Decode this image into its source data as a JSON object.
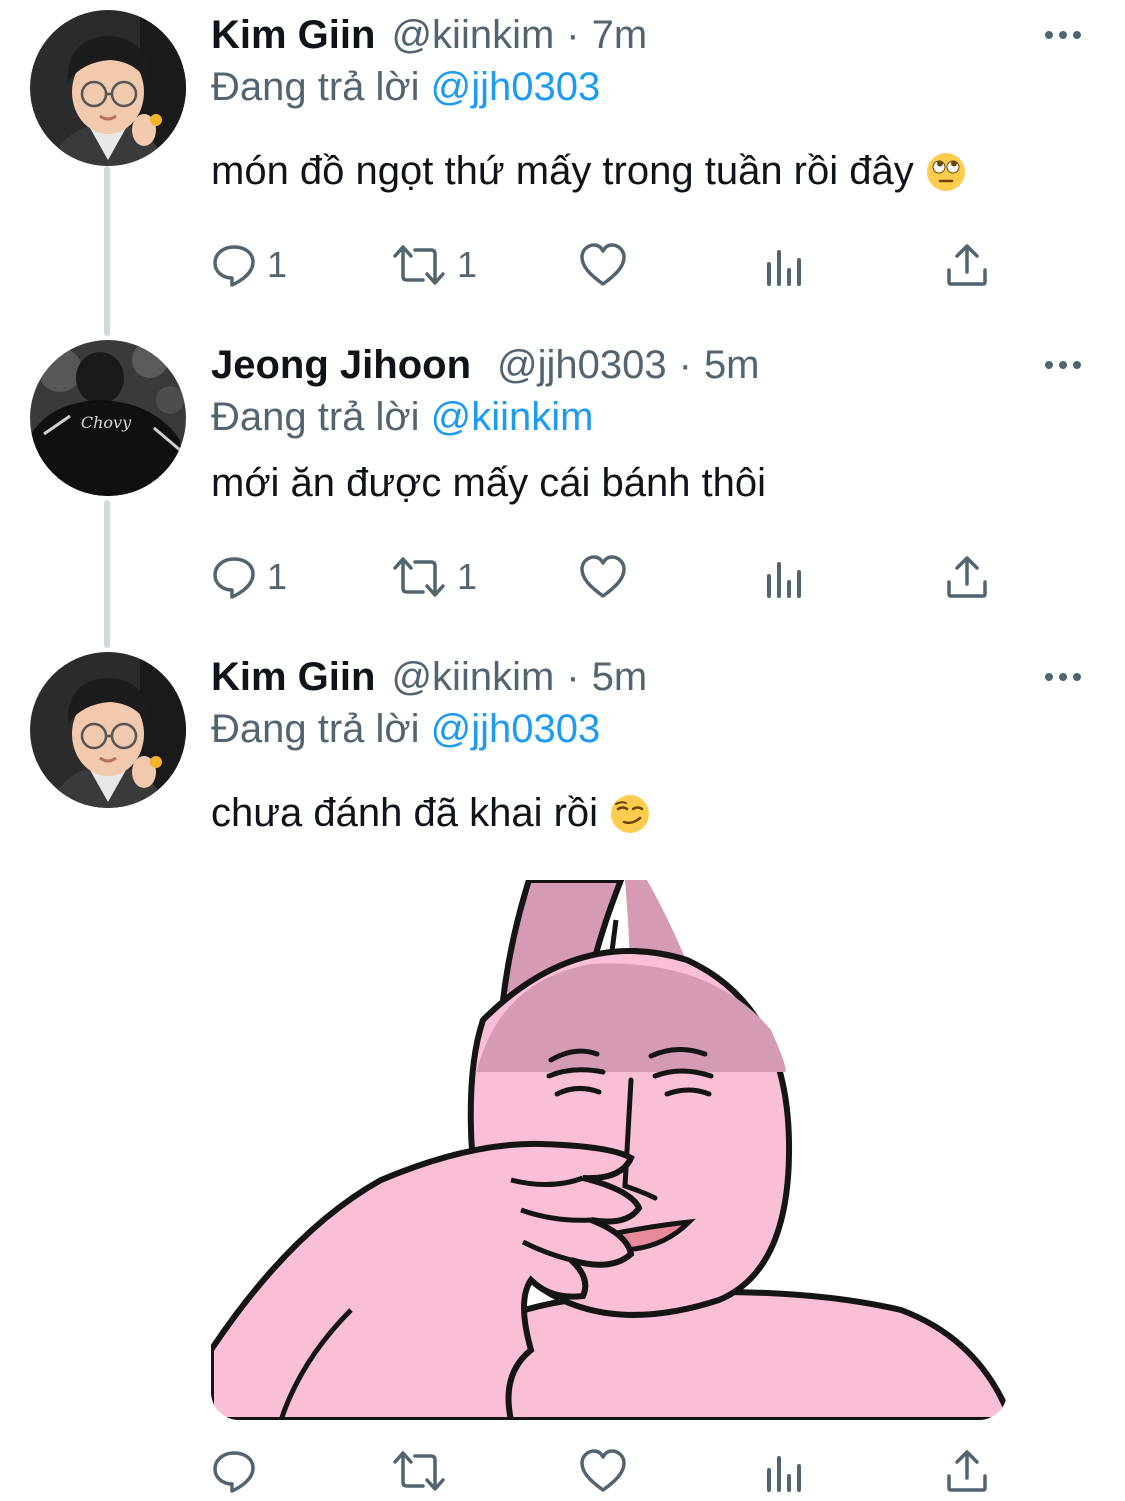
{
  "colors": {
    "text": "#0f1419",
    "secondary": "#536471",
    "accent": "#1d9bf0",
    "thread_line": "#cfd9de"
  },
  "replying_prefix": "Đang trả lời",
  "tweets": [
    {
      "name": "Kim Giin",
      "handle": "@kiinkim",
      "dot": "·",
      "time": "7m",
      "reply_to": "@jjh0303",
      "text": "món đồ ngọt thứ mấy trong tuần rồi đây",
      "emoji": "face-with-rolling-eyes",
      "replies": "1",
      "retweets": "1",
      "likes": ""
    },
    {
      "name": "Jeong Jihoon",
      "handle": "@jjh0303",
      "dot": "·",
      "time": "5m",
      "reply_to": "@kiinkim",
      "text": "mới ăn được mấy cái bánh thôi",
      "replies": "1",
      "retweets": "1",
      "likes": "",
      "avatar_jersey_text": "Chovy"
    },
    {
      "name": "Kim Giin",
      "handle": "@kiinkim",
      "dot": "·",
      "time": "5m",
      "reply_to": "@jjh0303",
      "text": "chưa đánh đã khai rồi",
      "emoji": "smirking-face",
      "media": "pink-bunny-sticker",
      "replies": "",
      "retweets": "",
      "likes": ""
    }
  ],
  "icons": [
    "reply-icon",
    "retweet-icon",
    "like-icon",
    "analytics-icon",
    "share-icon",
    "more-icon"
  ]
}
